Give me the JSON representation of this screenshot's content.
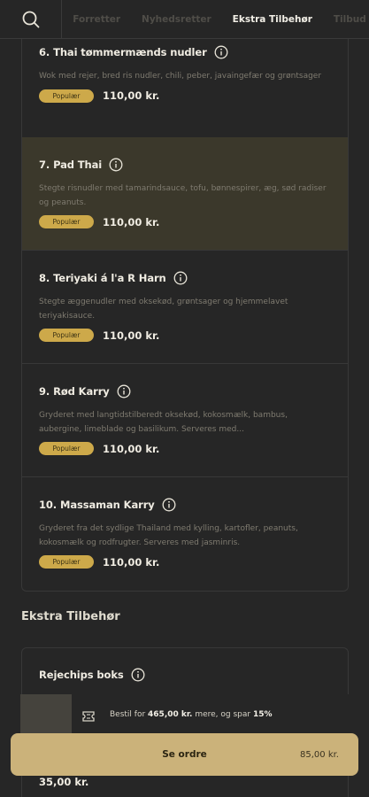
{
  "header": {
    "search_icon": "search-icon",
    "tabs": [
      {
        "label": "Forretter",
        "active": false
      },
      {
        "label": "Nyhedsretter",
        "active": false
      },
      {
        "label": "Ekstra Tilbehør",
        "active": true
      },
      {
        "label": "Tilbud",
        "active": false
      }
    ]
  },
  "menu": {
    "items": [
      {
        "title": "6. Thai tømmermænds nudler",
        "description": "Wok med rejer, bred ris nudler, chili, peber, javaingefær og grøntsager",
        "badge": "Populær",
        "price": "110,00 kr.",
        "highlighted": false
      },
      {
        "title": "7. Pad Thai",
        "description": "Stegte risnudler med tamarindsauce, tofu, bønnespirer, æg, sød radiser og peanuts.",
        "badge": "Populær",
        "price": "110,00 kr.",
        "highlighted": true
      },
      {
        "title": "8. Teriyaki á l'a R Harn",
        "description": "Stegte æggenudler med oksekød, grøntsager og hjemmelavet teriyakisauce.",
        "badge": "Populær",
        "price": "110,00 kr.",
        "highlighted": false
      },
      {
        "title": "9. Rød Karry",
        "description": "Gryderet med langtidstilberedt oksekød, kokosmælk, bambus, aubergine, limeblade og basilikum. Serveres med...",
        "badge": "Populær",
        "price": "110,00 kr.",
        "highlighted": false
      },
      {
        "title": "10. Massaman Karry",
        "description": "Gryderet fra det sydlige Thailand med kylling, kartofler, peanuts, kokosmælk og rodfrugter. Serveres med jasminris.",
        "badge": "Populær",
        "price": "110,00 kr.",
        "highlighted": false
      }
    ]
  },
  "extras": {
    "section_title": "Ekstra Tilbehør",
    "items": [
      {
        "title": "Rejechips boks",
        "price": "35,00 kr."
      }
    ]
  },
  "promo": {
    "prefix": "Bestil for ",
    "amount": "465,00 kr.",
    "middle": " mere, og spar ",
    "percent": "15%"
  },
  "order": {
    "label": "Se ordre",
    "total": "85,00 kr."
  },
  "colors": {
    "background": "#262626",
    "accent_gold": "#cda94a",
    "order_button": "#cbb27a",
    "highlight_row": "#3b382b"
  }
}
